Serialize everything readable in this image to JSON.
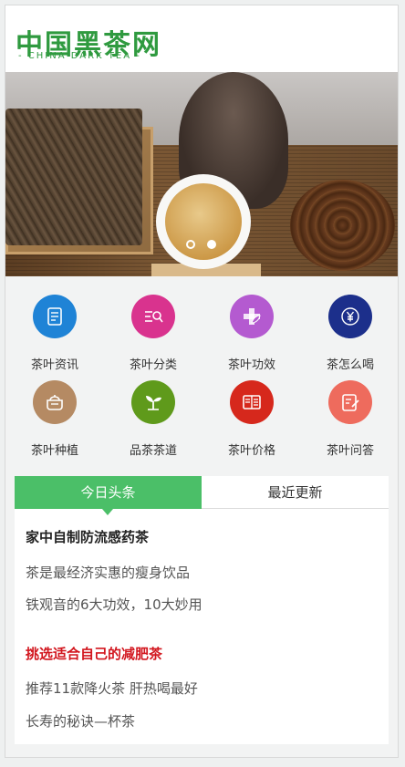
{
  "logo": {
    "title_cn": "中国黑茶网",
    "title_en": "- CHINA DARK TEA -"
  },
  "banner": {
    "slides": 2,
    "active_slide": 2
  },
  "categories": [
    {
      "label": "茶叶资讯",
      "icon": "document-icon",
      "color": "#1f83d6"
    },
    {
      "label": "茶叶分类",
      "icon": "list-search-icon",
      "color": "#d9338e"
    },
    {
      "label": "茶叶功效",
      "icon": "plus-leaf-icon",
      "color": "#b45ad0"
    },
    {
      "label": "茶怎么喝",
      "icon": "yen-coin-icon",
      "color": "#1c2f8b"
    },
    {
      "label": "茶叶种植",
      "icon": "pot-icon",
      "color": "#b58a63"
    },
    {
      "label": "品茶茶道",
      "icon": "sprout-icon",
      "color": "#5f9a1b"
    },
    {
      "label": "茶叶价格",
      "icon": "price-list-icon",
      "color": "#d6281c"
    },
    {
      "label": "茶叶问答",
      "icon": "edit-note-icon",
      "color": "#ee6b5d"
    }
  ],
  "tabs": {
    "active": "今日头条",
    "inactive": "最近更新"
  },
  "news": [
    {
      "text": "家中自制防流感药茶",
      "style": "headline"
    },
    {
      "text": "茶是最经济实惠的瘦身饮品",
      "style": "normal"
    },
    {
      "text": "铁观音的6大功效，10大妙用",
      "style": "normal"
    },
    {
      "text": "挑选适合自己的减肥茶",
      "style": "red"
    },
    {
      "text": "推荐11款降火茶 肝热喝最好",
      "style": "normal"
    },
    {
      "text": "长寿的秘诀—杯茶",
      "style": "normal"
    }
  ]
}
